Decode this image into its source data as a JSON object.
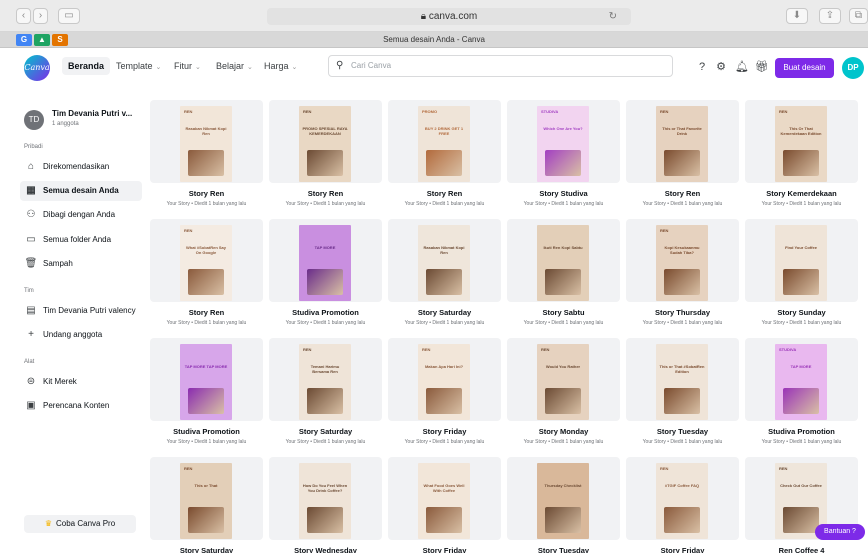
{
  "browser": {
    "url": "canva.com",
    "lock_icon": "lock-icon",
    "tab_title": "Semua desain Anda - Canva"
  },
  "nav": {
    "logo": "Canva",
    "items": [
      "Beranda",
      "Template",
      "Fitur",
      "Belajar",
      "Harga"
    ],
    "search_placeholder": "Cari Canva",
    "create_button": "Buat desain",
    "avatar_initials": "DP"
  },
  "sidebar": {
    "team_initials": "TD",
    "team_name": "Tim Devania Putri v...",
    "team_members": "1 anggota",
    "section_private": "Pribadi",
    "items_private": [
      {
        "label": "Direkomendasikan",
        "icon": "home-icon"
      },
      {
        "label": "Semua desain Anda",
        "icon": "grid-icon"
      },
      {
        "label": "Dibagi dengan Anda",
        "icon": "shared-users-icon"
      },
      {
        "label": "Semua folder Anda",
        "icon": "folder-icon"
      },
      {
        "label": "Sampah",
        "icon": "trash-icon"
      }
    ],
    "section_team": "Tim",
    "items_team": [
      {
        "label": "Tim Devania Putri valency",
        "icon": "team-building-icon"
      },
      {
        "label": "Undang anggota",
        "icon": "plus-icon"
      }
    ],
    "section_tools": "Alat",
    "items_tools": [
      {
        "label": "Kit Merek",
        "icon": "brand-kit-icon"
      },
      {
        "label": "Perencana Konten",
        "icon": "calendar-icon"
      }
    ],
    "try_pro": "Coba Canva Pro"
  },
  "designs": [
    {
      "title": "Story Ren",
      "sub": "Your Story • Diedit 1 bulan yang lalu",
      "bg": "#f2e6d9",
      "accent": "#8a5a3c",
      "brand": "REN",
      "headline": "Rasakan Nikmat Kopi Ren"
    },
    {
      "title": "Story Ren",
      "sub": "Your Story • Diedit 1 bulan yang lalu",
      "bg": "#e9d8c4",
      "accent": "#6b4a33",
      "brand": "REN",
      "headline": "PROMO SPESIAL RAYA KEMERDEKAAN"
    },
    {
      "title": "Story Ren",
      "sub": "Your Story • Diedit 1 bulan yang lalu",
      "bg": "#efe4d8",
      "accent": "#b26a3c",
      "brand": "PROMO",
      "headline": "BUY 2 DRINK GET 1 FREE"
    },
    {
      "title": "Story Studiva",
      "sub": "Your Story • Diedit 1 bulan yang lalu",
      "bg": "#f2d4f0",
      "accent": "#a23fc2",
      "brand": "STUDIVA",
      "headline": "Which One Are You?"
    },
    {
      "title": "Story Ren",
      "sub": "Your Story • Diedit 1 bulan yang lalu",
      "bg": "#e6d2bf",
      "accent": "#7a4b2e",
      "brand": "REN",
      "headline": "This or That Favorite Drink"
    },
    {
      "title": "Story Kemerdekaan",
      "sub": "Your Story • Diedit 1 bulan yang lalu",
      "bg": "#ead9c6",
      "accent": "#7a4b2e",
      "brand": "REN",
      "headline": "This Or That Kemerdekaan Edition"
    },
    {
      "title": "Story Ren",
      "sub": "Your Story • Diedit 1 bulan yang lalu",
      "bg": "#f4ebe2",
      "accent": "#8a5a3c",
      "brand": "REN",
      "headline": "What #SobatRen Say On Google"
    },
    {
      "title": "Studiva Promotion",
      "sub": "Your Story • Diedit 1 bulan yang lalu",
      "bg": "#c98fe0",
      "accent": "#6a2c8a",
      "brand": "",
      "headline": "TAP MORE"
    },
    {
      "title": "Story Saturday",
      "sub": "Your Story • Diedit 1 bulan yang lalu",
      "bg": "#efe6db",
      "accent": "#6b4a33",
      "brand": "",
      "headline": "Rasakan Nikmat Kopi Ren"
    },
    {
      "title": "Story Sabtu",
      "sub": "Your Story • Diedit 1 bulan yang lalu",
      "bg": "#e3cfb8",
      "accent": "#6b4a33",
      "brand": "",
      "headline": "Ikuti Ren Kopi Sabtu"
    },
    {
      "title": "Story Thursday",
      "sub": "Your Story • Diedit 1 bulan yang lalu",
      "bg": "#e6d2bf",
      "accent": "#7a4b2e",
      "brand": "REN",
      "headline": "Kopi Kesukaanmu Sudah Tiba?"
    },
    {
      "title": "Story Sunday",
      "sub": "Your Story • Diedit 1 bulan yang lalu",
      "bg": "#efe4d8",
      "accent": "#7a4b2e",
      "brand": "",
      "headline": "Find Your Coffee"
    },
    {
      "title": "Studiva Promotion",
      "sub": "Your Story • Diedit 1 bulan yang lalu",
      "bg": "#d7a6ea",
      "accent": "#8a2cb0",
      "brand": "",
      "headline": "TAP MORE TAP MORE"
    },
    {
      "title": "Story Saturday",
      "sub": "Your Story • Diedit 1 bulan yang lalu",
      "bg": "#efe4d8",
      "accent": "#6b4a33",
      "brand": "REN",
      "headline": "Temani Harimu Bersama Ren"
    },
    {
      "title": "Story Friday",
      "sub": "Your Story • Diedit 1 bulan yang lalu",
      "bg": "#f2e6d9",
      "accent": "#8a5a3c",
      "brand": "REN",
      "headline": "Makan Apa Hari Ini?"
    },
    {
      "title": "Story Monday",
      "sub": "Your Story • Diedit 1 bulan yang lalu",
      "bg": "#e6d2bf",
      "accent": "#6b4a33",
      "brand": "REN",
      "headline": "Would You Rather"
    },
    {
      "title": "Story Tuesday",
      "sub": "Your Story • Diedit 1 bulan yang lalu",
      "bg": "#efe4d8",
      "accent": "#7a4b2e",
      "brand": "",
      "headline": "This or That #SobatRen Edition"
    },
    {
      "title": "Studiva Promotion",
      "sub": "Your Story • Diedit 1 bulan yang lalu",
      "bg": "#e9b8ef",
      "accent": "#9a34b8",
      "brand": "STUDIVA",
      "headline": "TAP MORE"
    },
    {
      "title": "Story Saturday",
      "sub": "Your Story • Diedit 1 bulan yang lalu",
      "bg": "#e3cfb8",
      "accent": "#7a4b2e",
      "brand": "REN",
      "headline": "This or That"
    },
    {
      "title": "Story Wednesday",
      "sub": "Your Story • Diedit 1 bulan yang lalu",
      "bg": "#efe4d8",
      "accent": "#6b4a33",
      "brand": "",
      "headline": "How Do You Feel When You Drink Coffee?"
    },
    {
      "title": "Story Friday",
      "sub": "Your Story • Diedit 1 bulan yang lalu",
      "bg": "#f2e6d9",
      "accent": "#8a5a3c",
      "brand": "",
      "headline": "What Food Goes Well With Coffee"
    },
    {
      "title": "Story Tuesday",
      "sub": "Your Story • Diedit 1 bulan yang lalu",
      "bg": "#d9b89a",
      "accent": "#6b4a33",
      "brand": "",
      "headline": "Thursday Checklist"
    },
    {
      "title": "Story Friday",
      "sub": "Your Story • Diedit 1 bulan yang lalu",
      "bg": "#efe4d8",
      "accent": "#8a5a3c",
      "brand": "REN",
      "headline": "#TGIF Coffee FAQ"
    },
    {
      "title": "Ren Coffee 4",
      "sub": "",
      "bg": "#efe6db",
      "accent": "#6b4a33",
      "brand": "REN",
      "headline": "Check Out Our Coffee"
    }
  ],
  "help_button": "Bantuan ?"
}
